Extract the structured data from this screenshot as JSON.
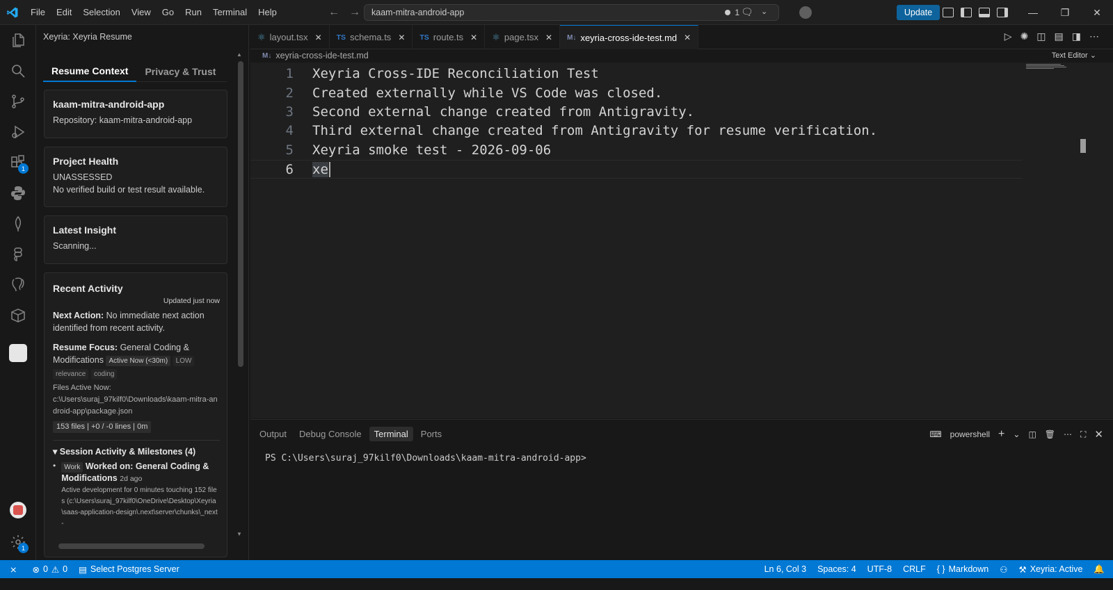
{
  "menu": [
    "File",
    "Edit",
    "Selection",
    "View",
    "Go",
    "Run",
    "Terminal",
    "Help"
  ],
  "command_center": {
    "text": "kaam-mitra-android-app",
    "dirty_count": "1"
  },
  "update_label": "Update",
  "activity_badges": {
    "extensions": "1",
    "settings": "1"
  },
  "sidebar": {
    "title": "Xeyria: Xeyria Resume",
    "tabs": [
      "Resume Context",
      "Privacy & Trust"
    ],
    "repo_card": {
      "name": "kaam-mitra-android-app",
      "repository": "Repository: kaam-mitra-android-app"
    },
    "health_card": {
      "title": "Project Health",
      "status": "UNASSESSED",
      "detail": "No verified build or test result available."
    },
    "insight_card": {
      "title": "Latest Insight",
      "text": "Scanning..."
    },
    "activity_card": {
      "title": "Recent Activity",
      "updated": "Updated just now",
      "next_action_label": "Next Action:",
      "next_action_text": " No immediate next action identified from recent activity.",
      "focus_label": "Resume Focus:",
      "focus_text": " General Coding & Modifications",
      "badge_active": "Active Now (<30m)",
      "badge_low": "LOW",
      "badge_relevance": "relevance",
      "badge_coding": "coding",
      "files_active_label": "Files Active Now:",
      "files_active_path": "c:\\Users\\suraj_97kilf0\\Downloads\\kaam-mitra-android-app\\package.json",
      "stats": "153 files | +0 / -0 lines | 0m",
      "session_title": "Session Activity & Milestones (4)",
      "milestone_badge": "Work",
      "milestone_title": "Worked on: General Coding & Modifications",
      "milestone_time": "2d ago",
      "milestone_detail": "Active development for 0 minutes touching 152 files (c:\\Users\\suraj_97kilf0\\OneDrive\\Desktop\\Xeyria\\saas-application-design\\.next\\server\\chunks\\_next-"
    }
  },
  "tabs": [
    {
      "label": "layout.tsx",
      "kind": "react"
    },
    {
      "label": "schema.ts",
      "kind": "ts"
    },
    {
      "label": "route.ts",
      "kind": "ts"
    },
    {
      "label": "page.tsx",
      "kind": "react"
    },
    {
      "label": "xeyria-cross-ide-test.md",
      "kind": "md",
      "active": true
    }
  ],
  "breadcrumb": "xeyria-cross-ide-test.md",
  "text_editor_label": "Text Editor",
  "editor_lines": [
    {
      "n": "1",
      "text": "Xeyria Cross-IDE Reconciliation Test"
    },
    {
      "n": "2",
      "text": "Created externally while VS Code was closed."
    },
    {
      "n": "3",
      "text": "Second external change created from Antigravity."
    },
    {
      "n": "4",
      "text": "Third external change created from Antigravity for resume verification."
    },
    {
      "n": "5",
      "text": "Xeyria smoke test - 2026-09-06"
    },
    {
      "n": "6",
      "text": "xe"
    }
  ],
  "panel": {
    "tabs": [
      "Output",
      "Debug Console",
      "Terminal",
      "Ports"
    ],
    "active_tab": "Terminal",
    "shell": "powershell",
    "prompt": "PS C:\\Users\\suraj_97kilf0\\Downloads\\kaam-mitra-android-app>"
  },
  "status": {
    "errors": "0",
    "warnings": "0",
    "postgres": "Select Postgres Server",
    "position": "Ln 6, Col 3",
    "spaces": "Spaces: 4",
    "encoding": "UTF-8",
    "eol": "CRLF",
    "language": "Markdown",
    "xeyria": "Xeyria: Active"
  },
  "colors": {
    "accent": "#0078d4",
    "statusbar": "#0078d4",
    "update": "#0e639c"
  }
}
